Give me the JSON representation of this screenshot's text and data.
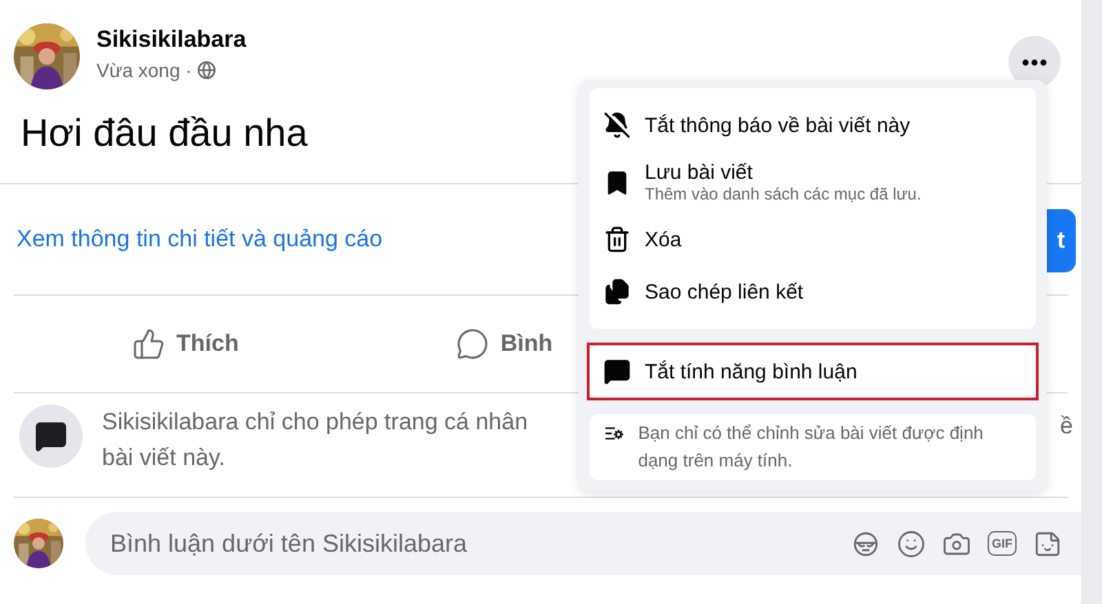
{
  "post": {
    "author": "Sikisikilabara",
    "time": "Vừa xong ·",
    "text": "Hơi đâu đầu nha",
    "link": "Xem thông tin chi tiết và quảng cáo",
    "button_fragment": "t"
  },
  "actions": [
    {
      "kind": "like",
      "label": "Thích"
    },
    {
      "kind": "comment",
      "label": "Bình"
    }
  ],
  "notice": {
    "lines": [
      "Sikisikilabara chỉ cho phép trang cá nhân",
      "bài viết này."
    ],
    "fragment": "ề"
  },
  "comment_box": {
    "placeholder": "Bình luận dưới tên Sikisikilabara",
    "tools": [
      {
        "kind": "mask"
      },
      {
        "kind": "emoji"
      },
      {
        "kind": "camera"
      },
      {
        "kind": "gif",
        "label": "GIF"
      },
      {
        "kind": "sticker"
      }
    ]
  },
  "menu": {
    "groups": [
      {
        "items": [
          {
            "kind": "mute",
            "title": "Tắt thông báo về bài viết này",
            "highlighted": false
          },
          {
            "kind": "save",
            "title": "Lưu bài viết",
            "subtitle": "Thêm vào danh sách các mục đã lưu.",
            "highlighted": false
          },
          {
            "kind": "delete",
            "title": "Xóa",
            "highlighted": false
          },
          {
            "kind": "copy",
            "title": "Sao chép liên kết",
            "highlighted": false
          }
        ]
      },
      {
        "items": [
          {
            "kind": "comments",
            "title": "Tắt tính năng bình luận",
            "highlighted": true
          }
        ]
      },
      {
        "items": [
          {
            "kind": "note",
            "note": "Bạn chỉ có thể chỉnh sửa bài viết được định dạng trên máy tính.",
            "highlighted": false
          }
        ]
      }
    ]
  }
}
